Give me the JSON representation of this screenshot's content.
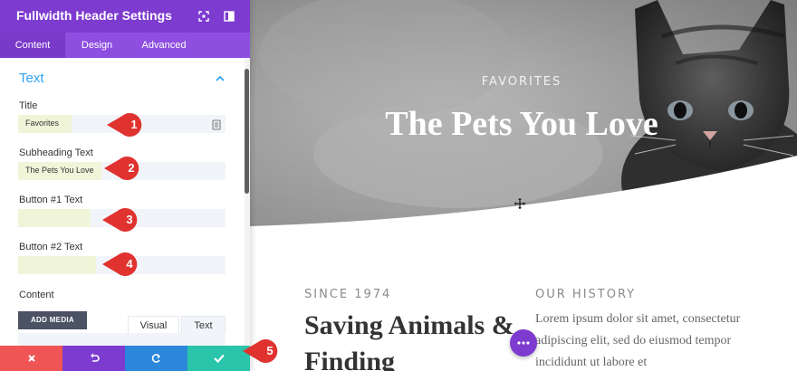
{
  "panel": {
    "title": "Fullwidth Header Settings",
    "tabs": [
      "Content",
      "Design",
      "Advanced"
    ],
    "section_title": "Text",
    "fields": {
      "title_label": "Title",
      "title_value": "Favorites",
      "subheading_label": "Subheading Text",
      "subheading_value": "The Pets You Love",
      "button1_label": "Button #1 Text",
      "button1_value": "",
      "button2_label": "Button #2 Text",
      "button2_value": "",
      "content_label": "Content"
    },
    "add_media_label": "ADD MEDIA",
    "editor_tabs": [
      "Visual",
      "Text"
    ]
  },
  "callouts": [
    "1",
    "2",
    "3",
    "4",
    "5"
  ],
  "preview": {
    "hero_label": "FAVORITES",
    "hero_title": "The Pets You Love",
    "since_label": "SINCE 1974",
    "history_label": "OUR HISTORY",
    "heading": "Saving Animals & Finding",
    "body_text": "Lorem ipsum dolor sit amet, consectetur adipiscing elit, sed do eiusmod tempor incididunt ut labore et"
  },
  "colors": {
    "purple": "#7d3bcf",
    "tab_purple": "#8e4ee0",
    "section_blue": "#2ea3f2",
    "cancel_red": "#ef5555",
    "redo_blue": "#2b87da",
    "save_green": "#29c4a9",
    "callout_red": "#e0322f"
  },
  "icons": [
    "fullscreen-icon",
    "sidebar-toggle-icon",
    "chevron-up-icon",
    "dynamic-content-icon",
    "close-icon",
    "undo-icon",
    "redo-icon",
    "check-icon",
    "move-cursor-icon",
    "more-dots-icon"
  ]
}
